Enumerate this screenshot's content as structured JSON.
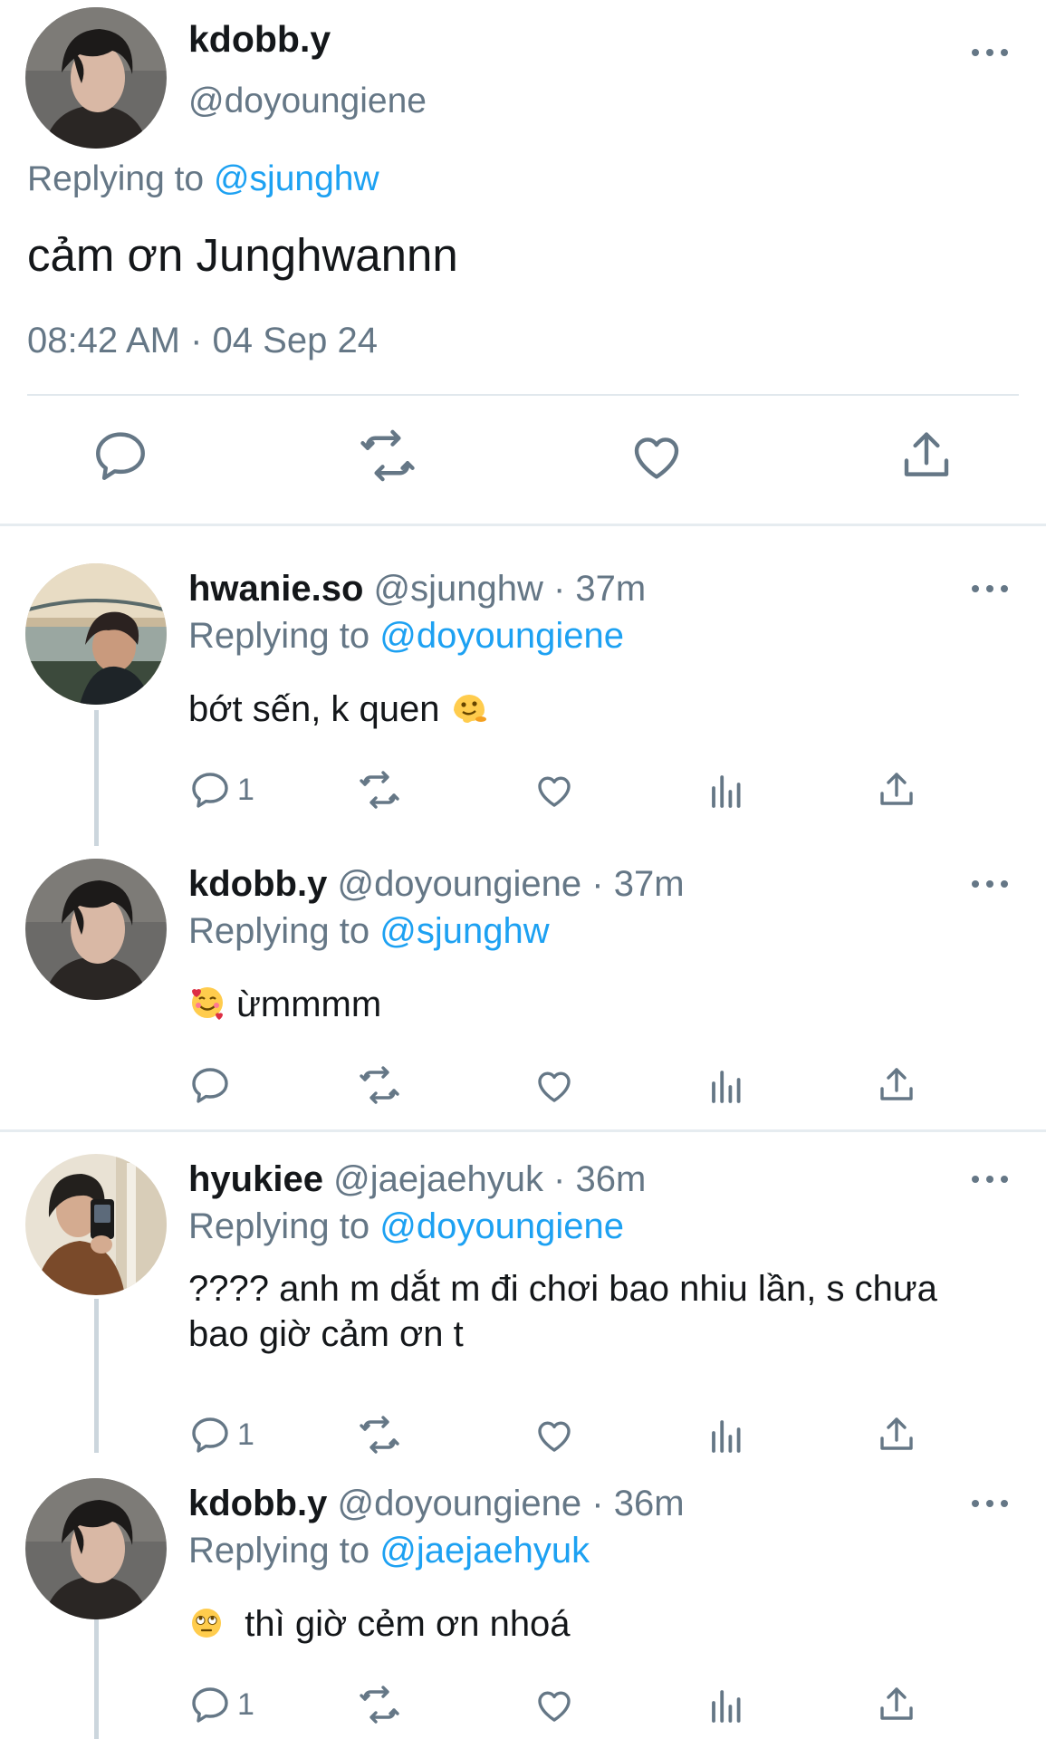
{
  "main_tweet": {
    "display_name": "kdobb.y",
    "handle": "@doyoungiene",
    "replying_prefix": "Replying to ",
    "replying_to": "@sjunghw",
    "text": "cảm ơn Junghwannn",
    "timestamp": "08:42 AM · 04 Sep 24"
  },
  "replies": [
    {
      "display_name": "hwanie.so",
      "handle_time": " @sjunghw · 37m",
      "replying_prefix": "Replying to ",
      "replying_to": "@doyoungiene",
      "text": "bớt sến, k quen",
      "emoji": "melting-face",
      "reply_count": "1"
    },
    {
      "display_name": "kdobb.y",
      "handle_time": " @doyoungiene · 37m",
      "replying_prefix": "Replying to ",
      "replying_to": "@sjunghw",
      "text": "ừmmmm",
      "emoji": "smiling-face-with-hearts",
      "reply_count": ""
    },
    {
      "display_name": "hyukiee",
      "handle_time": " @jaejaehyuk · 36m",
      "replying_prefix": "Replying to ",
      "replying_to": "@doyoungiene",
      "text_line1": "???? anh m dắt m đi chơi bao nhiu lần, s chưa",
      "text_line2": "bao giờ cảm ơn t",
      "reply_count": "1"
    },
    {
      "display_name": "kdobb.y",
      "handle_time": " @doyoungiene · 36m",
      "replying_prefix": "Replying to ",
      "replying_to": "@jaejaehyuk",
      "text": "thì giờ cẻm ơn nhoá",
      "emoji": "face-with-rolling-eyes",
      "reply_count": "1"
    }
  ],
  "colors": {
    "text": "#14171a",
    "secondary": "#657786",
    "link": "#1da1f2",
    "divider": "#e1e8ed",
    "thread_line": "#ccd6dd"
  }
}
